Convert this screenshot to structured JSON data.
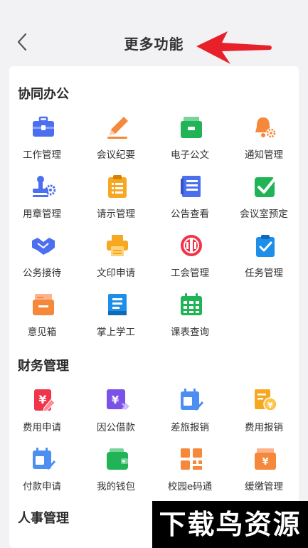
{
  "header": {
    "title": "更多功能"
  },
  "sections": [
    {
      "title": "协同办公",
      "items": [
        {
          "label": "工作管理",
          "icon": "briefcase-icon"
        },
        {
          "label": "会议纪要",
          "icon": "pencil-icon"
        },
        {
          "label": "电子公文",
          "icon": "document-folder-icon"
        },
        {
          "label": "通知管理",
          "icon": "bell-gear-icon"
        },
        {
          "label": "用章管理",
          "icon": "stamp-gear-icon"
        },
        {
          "label": "请示管理",
          "icon": "clipboard-list-icon"
        },
        {
          "label": "公告查看",
          "icon": "notice-book-icon"
        },
        {
          "label": "会议室预定",
          "icon": "check-box-icon"
        },
        {
          "label": "公务接待",
          "icon": "handshake-icon"
        },
        {
          "label": "文印申请",
          "icon": "printer-icon"
        },
        {
          "label": "工会管理",
          "icon": "union-badge-icon"
        },
        {
          "label": "任务管理",
          "icon": "task-clipboard-icon"
        },
        {
          "label": "意见箱",
          "icon": "mailbox-icon"
        },
        {
          "label": "掌上学工",
          "icon": "study-book-icon"
        },
        {
          "label": "课表查询",
          "icon": "calendar-grid-icon"
        }
      ]
    },
    {
      "title": "财务管理",
      "items": [
        {
          "label": "费用申请",
          "icon": "yuan-pen-icon"
        },
        {
          "label": "因公借款",
          "icon": "yuan-card-icon"
        },
        {
          "label": "差旅报销",
          "icon": "travel-calendar-icon"
        },
        {
          "label": "费用报销",
          "icon": "yuan-document-icon"
        },
        {
          "label": "付款申请",
          "icon": "payment-calendar-icon"
        },
        {
          "label": "我的钱包",
          "icon": "wallet-icon"
        },
        {
          "label": "校园e码通",
          "icon": "qr-code-icon"
        },
        {
          "label": "缓缴管理",
          "icon": "yuan-box-icon"
        }
      ]
    },
    {
      "title": "人事管理",
      "items": []
    }
  ],
  "watermark": "下载鸟资源",
  "colors": {
    "blue": "#4c6ff0",
    "orange": "#f5883a",
    "green": "#21b457",
    "yellow": "#f7a823",
    "red": "#f0344a",
    "arrow": "#e8202a"
  }
}
